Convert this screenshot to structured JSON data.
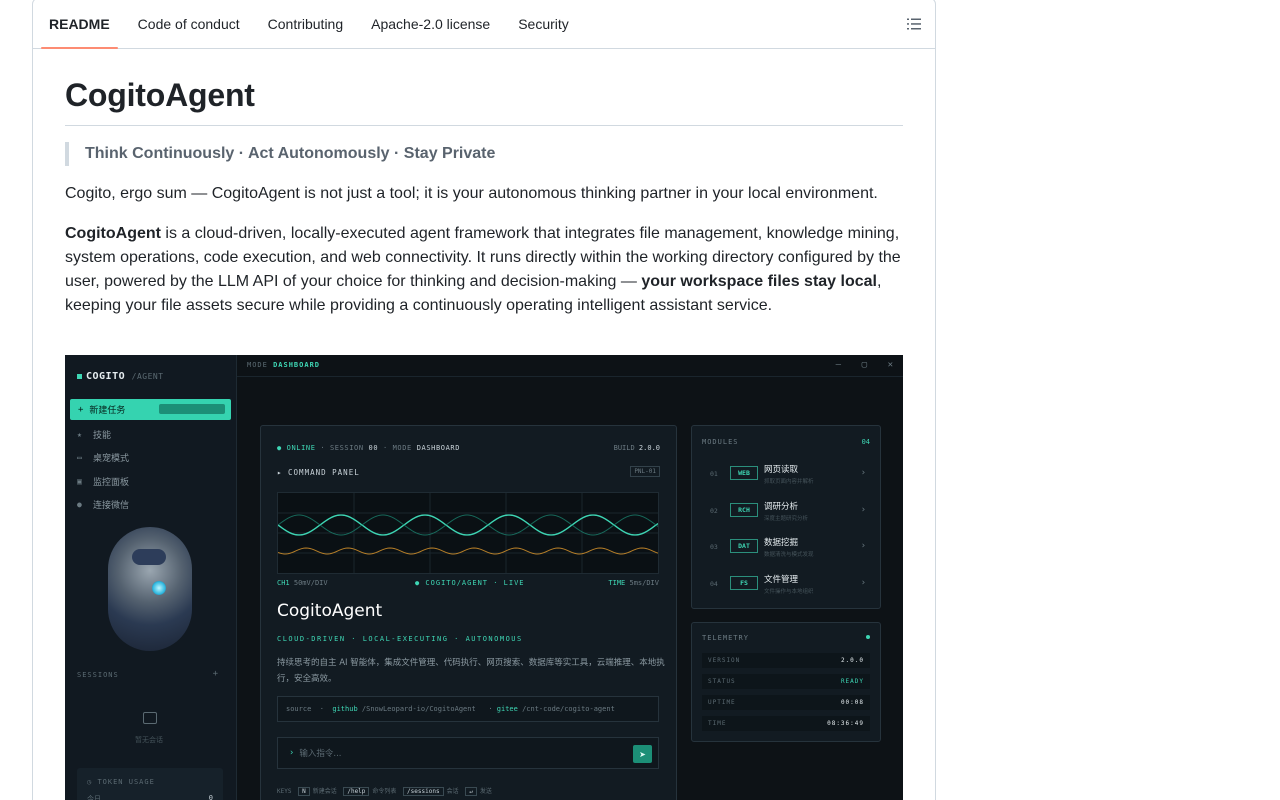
{
  "tabs": [
    {
      "label": "README",
      "active": true
    },
    {
      "label": "Code of conduct"
    },
    {
      "label": "Contributing"
    },
    {
      "label": "Apache-2.0 license"
    },
    {
      "label": "Security"
    }
  ],
  "readme": {
    "title": "CogitoAgent",
    "quote": "Think Continuously · Act Autonomously · Stay Private",
    "para1": "Cogito, ergo sum — CogitoAgent is not just a tool; it is your autonomous thinking partner in your local environment.",
    "para2": {
      "b1": "CogitoAgent",
      "t1": " is a cloud-driven, locally-executed agent framework that integrates file management, knowledge mining, system operations, code execution, and web connectivity. It runs directly within the working directory configured by the user, powered by the LLM API of your choice for thinking and decision-making — ",
      "b2": "your workspace files stay local",
      "t2": ", keeping your file assets secure while providing a continuously operating intelligent assistant service."
    }
  },
  "shot": {
    "logo": "COGITO",
    "logo_sub": "/AGENT",
    "new_task": "新建任务",
    "nav": [
      "技能",
      "桌宠模式",
      "监控面板",
      "连接微信"
    ],
    "sessions": "SESSIONS",
    "sessions_add": "+",
    "empty": "暂无会话",
    "token_label": "TOKEN USAGE",
    "token_row_label": "今日",
    "token_row_value": "0",
    "mode_label": "MODE",
    "mode_value": "DASHBOARD",
    "win": [
      "–",
      "▢",
      "✕"
    ],
    "status": {
      "online": "ONLINE",
      "session_l": "SESSION",
      "session_v": "00",
      "mode_l": "MODE",
      "mode_v": "DASHBOARD",
      "build_l": "BUILD",
      "build_v": "2.0.0"
    },
    "cmd_panel": "▸ COMMAND PANEL",
    "cmd_tag": "PNL-01",
    "scope_left_ch": "CH1",
    "scope_left": "50mV/DIV",
    "scope_center": "● COGITO/AGENT · LIVE",
    "scope_right_l": "TIME",
    "scope_right": "5ms/DIV",
    "title": "CogitoAgent",
    "tagline": "CLOUD-DRIVEN · LOCAL-EXECUTING · AUTONOMOUS",
    "desc": "持续思考的自主 AI 智能体，集成文件管理、代码执行、网页搜索、数据库等实工具，云端推理、本地执行，安全高效。",
    "src_label": "source",
    "src_github": "github",
    "src_github_path": "/SnowLeopard-io/CogitoAgent",
    "src_gitee": "gitee",
    "src_gitee_path": "/cnt-code/cogito-agent",
    "input_placeholder": "输入指令...",
    "send": "➤",
    "keys": {
      "label": "KEYS",
      "k1": "N",
      "t1": "新建会话",
      "k2": "/help",
      "t2": "命令列表",
      "k3": "/sessions",
      "t3": "会话",
      "k4": "↵",
      "t4": "发送"
    },
    "modules_label": "MODULES",
    "modules_count": "04",
    "modules": [
      {
        "num": "01",
        "tag": "WEB",
        "name": "网页读取",
        "desc": "抓取页面内容并解析"
      },
      {
        "num": "02",
        "tag": "RCH",
        "name": "调研分析",
        "desc": "深度主题研究分析"
      },
      {
        "num": "03",
        "tag": "DAT",
        "name": "数据挖掘",
        "desc": "数据清洗与模式发现"
      },
      {
        "num": "04",
        "tag": "FS",
        "name": "文件管理",
        "desc": "文件操作与本地组织"
      }
    ],
    "telemetry_label": "TELEMETRY",
    "telemetry": [
      {
        "k": "VERSION",
        "v": "2.0.0"
      },
      {
        "k": "STATUS",
        "v": "READY"
      },
      {
        "k": "UPTIME",
        "v": "00:08"
      },
      {
        "k": "TIME",
        "v": "08:36:49"
      }
    ]
  }
}
